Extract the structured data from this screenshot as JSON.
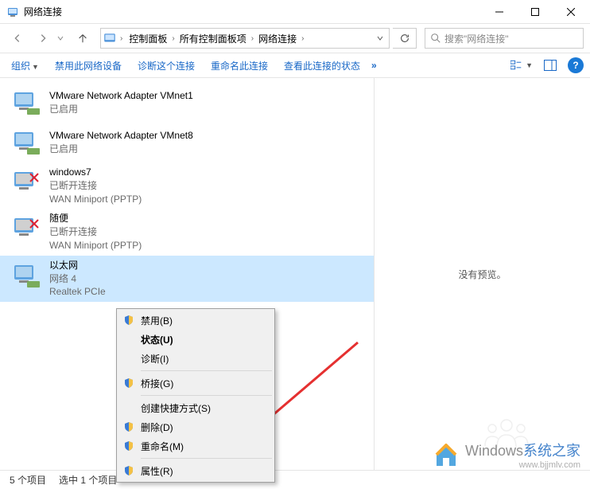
{
  "window": {
    "title": "网络连接"
  },
  "breadcrumb": {
    "items": [
      "控制面板",
      "所有控制面板项",
      "网络连接"
    ]
  },
  "search": {
    "placeholder": "搜索\"网络连接\""
  },
  "toolbar": {
    "organize": "组织",
    "disable": "禁用此网络设备",
    "diagnose": "诊断这个连接",
    "rename": "重命名此连接",
    "status": "查看此连接的状态"
  },
  "connections": [
    {
      "name": "VMware Network Adapter VMnet1",
      "status": "已启用",
      "device": ""
    },
    {
      "name": "VMware Network Adapter VMnet8",
      "status": "已启用",
      "device": ""
    },
    {
      "name": "windows7",
      "status": "已断开连接",
      "device": "WAN Miniport (PPTP)"
    },
    {
      "name": "随便",
      "status": "已断开连接",
      "device": "WAN Miniport (PPTP)"
    },
    {
      "name": "以太网",
      "status": "网络 4",
      "device": "Realtek PCIe"
    }
  ],
  "preview": {
    "no_preview": "没有预览。"
  },
  "context_menu": {
    "disable": "禁用(B)",
    "status": "状态(U)",
    "diagnose": "诊断(I)",
    "bridge": "桥接(G)",
    "shortcut": "创建快捷方式(S)",
    "delete": "删除(D)",
    "rename": "重命名(M)",
    "properties": "属性(R)"
  },
  "statusbar": {
    "count": "5 个项目",
    "selected": "选中 1 个项目"
  },
  "watermark": {
    "brand": "Windows",
    "suffix": "系统之家",
    "url": "www.bjjmlv.com"
  }
}
